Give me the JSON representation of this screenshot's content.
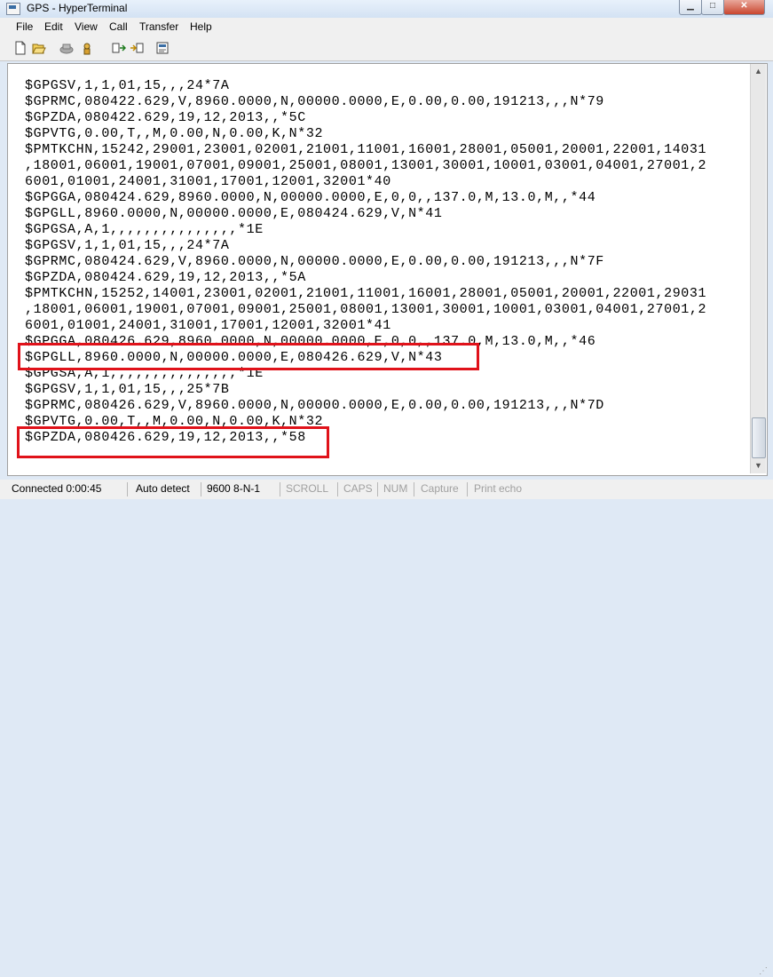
{
  "window": {
    "title": "GPS - HyperTerminal",
    "icon": "hyperterminal-app-icon"
  },
  "window_buttons": {
    "minimize": "▁",
    "maximize": "□",
    "close": "✕"
  },
  "menu": [
    "File",
    "Edit",
    "View",
    "Call",
    "Transfer",
    "Help"
  ],
  "toolbar": [
    {
      "name": "new-connection-icon",
      "glyph": "new"
    },
    {
      "name": "open-icon",
      "glyph": "open"
    },
    {
      "name": "call-icon",
      "glyph": "call"
    },
    {
      "name": "disconnect-icon",
      "glyph": "disconnect"
    },
    {
      "name": "send-icon",
      "glyph": "send"
    },
    {
      "name": "receive-icon",
      "glyph": "receive"
    },
    {
      "name": "properties-icon",
      "glyph": "properties"
    }
  ],
  "terminal": {
    "lines": [
      "$GPGSV,1,1,01,15,,,24*7A",
      "$GPRMC,080422.629,V,8960.0000,N,00000.0000,E,0.00,0.00,191213,,,N*79",
      "$GPZDA,080422.629,19,12,2013,,*5C",
      "$GPVTG,0.00,T,,M,0.00,N,0.00,K,N*32",
      "$PMTKCHN,15242,29001,23001,02001,21001,11001,16001,28001,05001,20001,22001,14031",
      ",18001,06001,19001,07001,09001,25001,08001,13001,30001,10001,03001,04001,27001,2",
      "6001,01001,24001,31001,17001,12001,32001*40",
      "$GPGGA,080424.629,8960.0000,N,00000.0000,E,0,0,,137.0,M,13.0,M,,*44",
      "$GPGLL,8960.0000,N,00000.0000,E,080424.629,V,N*41",
      "$GPGSA,A,1,,,,,,,,,,,,,,,*1E",
      "$GPGSV,1,1,01,15,,,24*7A",
      "$GPRMC,080424.629,V,8960.0000,N,00000.0000,E,0.00,0.00,191213,,,N*7F",
      "$GPZDA,080424.629,19,12,2013,,*5A",
      "$PMTKCHN,15252,14001,23001,02001,21001,11001,16001,28001,05001,20001,22001,29031",
      ",18001,06001,19001,07001,09001,25001,08001,13001,30001,10001,03001,04001,27001,2",
      "6001,01001,24001,31001,17001,12001,32001*41",
      "$GPGGA,080426.629,8960.0000,N,00000.0000,E,0,0,,137.0,M,13.0,M,,*46",
      "$GPGLL,8960.0000,N,00000.0000,E,080426.629,V,N*43",
      "$GPGSA,A,1,,,,,,,,,,,,,,,*1E",
      "$GPGSV,1,1,01,15,,,25*7B",
      "$GPRMC,080426.629,V,8960.0000,N,00000.0000,E,0.00,0.00,191213,,,N*7D",
      "$GPVTG,0.00,T,,M,0.00,N,0.00,K,N*32",
      "$GPZDA,080426.629,19,12,2013,,*58"
    ]
  },
  "highlight_color": "#e0121a",
  "status": [
    {
      "label": "Connected 0:00:45",
      "dim": false
    },
    {
      "label": "Auto detect",
      "dim": false
    },
    {
      "label": "9600 8-N-1",
      "dim": false
    },
    {
      "label": "SCROLL",
      "dim": true
    },
    {
      "label": "CAPS",
      "dim": true
    },
    {
      "label": "NUM",
      "dim": true
    },
    {
      "label": "Capture",
      "dim": true
    },
    {
      "label": "Print echo",
      "dim": true
    }
  ]
}
